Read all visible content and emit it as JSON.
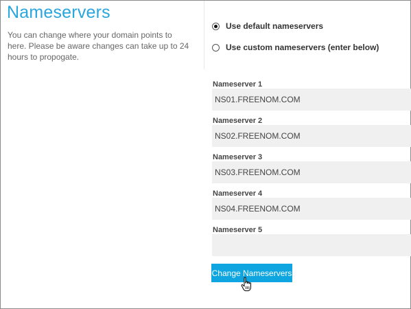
{
  "header": {
    "title": "Nameservers",
    "description": "You can change where your domain points to here. Please be aware changes can take up to 24 hours to propogate."
  },
  "options": {
    "default_label": "Use default nameservers",
    "custom_label": "Use custom nameservers (enter below)",
    "selected": "default"
  },
  "nameservers": [
    {
      "label": "Nameserver 1",
      "value": "NS01.FREENOM.COM"
    },
    {
      "label": "Nameserver 2",
      "value": "NS02.FREENOM.COM"
    },
    {
      "label": "Nameserver 3",
      "value": "NS03.FREENOM.COM"
    },
    {
      "label": "Nameserver 4",
      "value": "NS04.FREENOM.COM"
    },
    {
      "label": "Nameserver 5",
      "value": ""
    }
  ],
  "actions": {
    "submit_label": "Change Nameservers"
  },
  "colors": {
    "title": "#29a6dd",
    "button": "#0ea5e0",
    "field_bg": "#f0f0f0"
  }
}
